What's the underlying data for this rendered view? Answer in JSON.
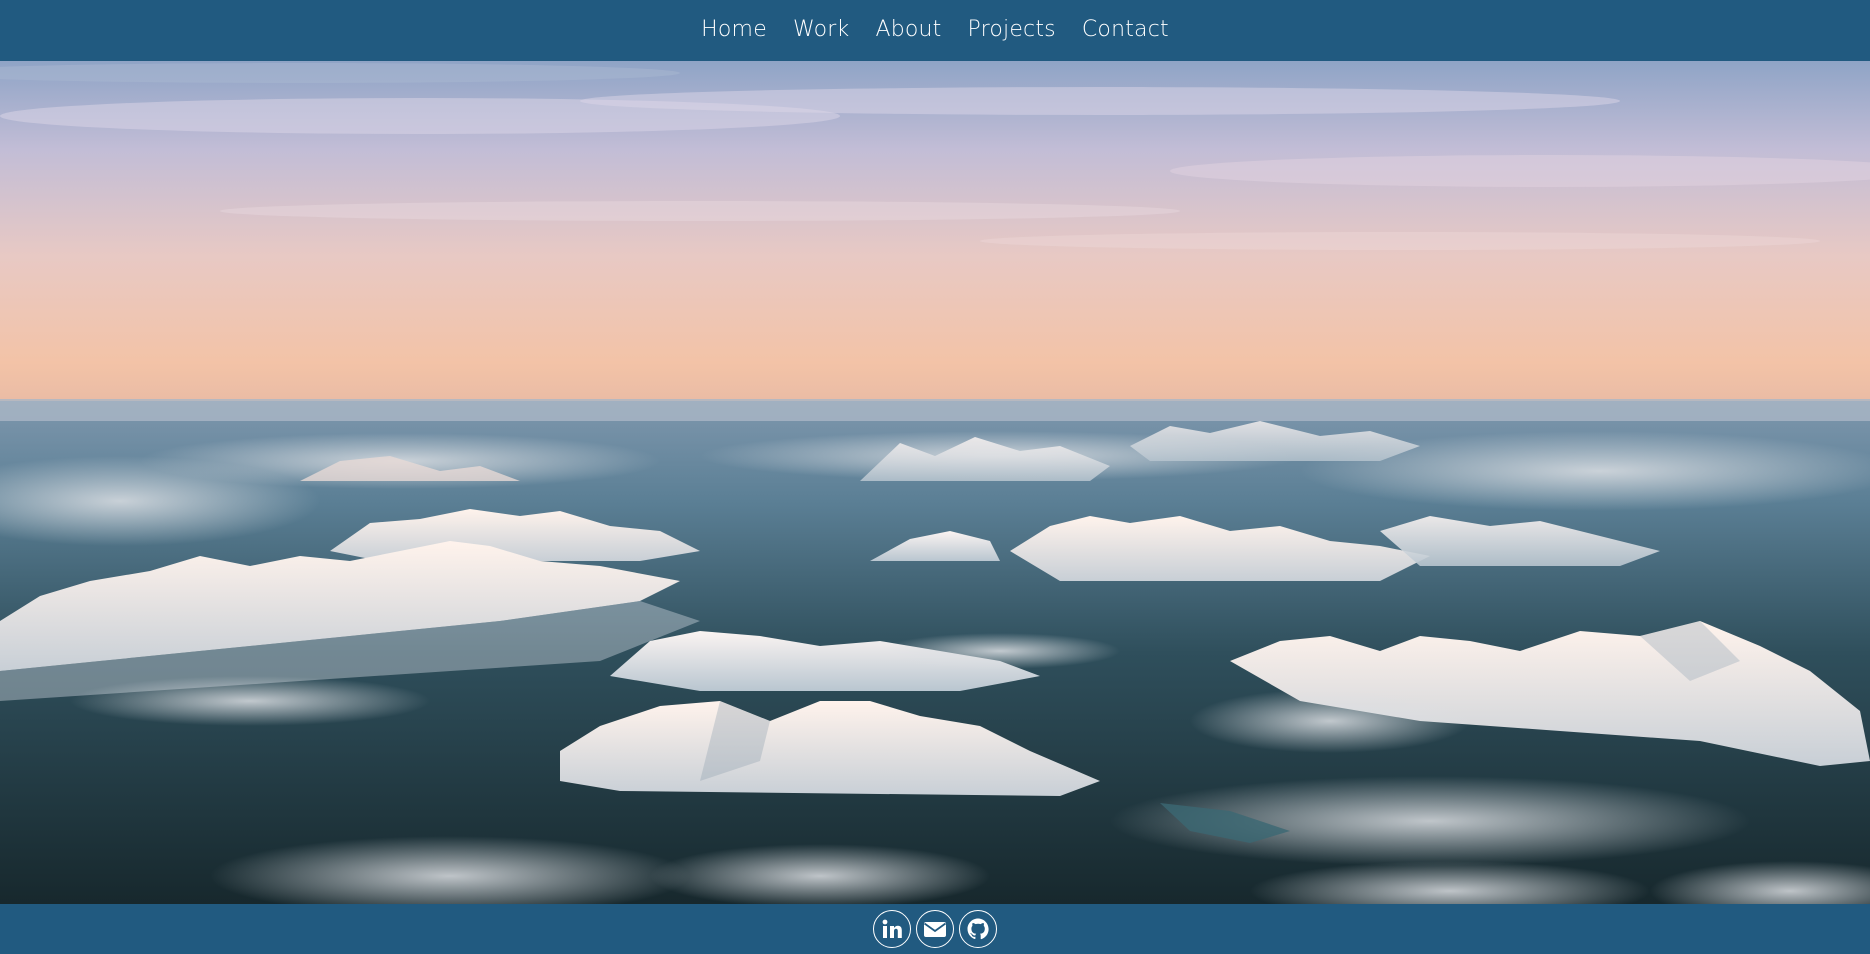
{
  "nav": {
    "items": [
      {
        "label": "Home"
      },
      {
        "label": "Work"
      },
      {
        "label": "About"
      },
      {
        "label": "Projects"
      },
      {
        "label": "Contact"
      }
    ]
  },
  "hero": {
    "image": "aerial-snowy-mountains-above-clouds-at-sunset"
  },
  "footer": {
    "icons": [
      "linkedin-icon",
      "email-icon",
      "github-icon"
    ]
  },
  "colors": {
    "bar": "#215a80",
    "text": "#ffffff"
  }
}
